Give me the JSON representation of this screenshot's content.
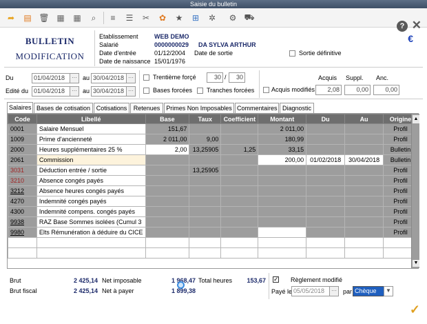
{
  "window": {
    "title": "Saisie du bulletin"
  },
  "toolbar": {
    "icons": [
      "back-arrow-icon",
      "document-icon",
      "trash-icon",
      "table-icon",
      "table-icon",
      "search-icon",
      "list-icon",
      "list-icon",
      "tools-icon",
      "gear-icon",
      "star-icon",
      "grid-icon",
      "gear-icon",
      "car-icon"
    ]
  },
  "header": {
    "title1": "BULLETIN",
    "title2": "MODIFICATION",
    "etab_label": "Etablissement",
    "etab_value": "WEB DEMO",
    "salarie_label": "Salarié",
    "salarie_id": "0000000029",
    "salarie_name": "DA SYLVA ARTHUR",
    "entree_label": "Date d'entrée",
    "entree_value": "01/12/2004",
    "sortie_label": "Date de sortie",
    "naissance_label": "Date de naissance",
    "naissance_value": "15/01/1976",
    "sortie_def_label": "Sortie définitive",
    "currency": "€"
  },
  "periods": {
    "du_label": "Du",
    "du_from": "01/04/2018",
    "au_label": "au",
    "du_to": "30/04/2018",
    "edite_label": "Edité du",
    "edite_from": "01/04/2018",
    "edite_au_label": "au",
    "edite_to": "30/04/2018",
    "trentieme_label": "Trentième forçé",
    "trentieme_num": "30",
    "trentieme_sep": "/",
    "trentieme_den": "30",
    "bases_label": "Bases forcées",
    "tranches_label": "Tranches forcées",
    "acquis_col": "Acquis",
    "suppl_col": "Suppl.",
    "anc_col": "Anc.",
    "acquis_mod_label": "Acquis modifiés",
    "acquis_value": "2,08",
    "suppl_value": "0,00",
    "anc_value": "0,00"
  },
  "tabs": [
    "Salaires",
    "Bases de cotisation",
    "Cotisations",
    "Retenues",
    "Primes Non Imposables",
    "Commentaires",
    "Diagnostic"
  ],
  "grid": {
    "headers": [
      "Code",
      "Libellé",
      "Base",
      "Taux",
      "Coefficient",
      "Montant",
      "Du",
      "Au",
      "Origine"
    ],
    "rows": [
      {
        "code": "0001",
        "label": "Salaire Mensuel",
        "base": "151,67",
        "taux": "",
        "coef": "",
        "montant": "2 011,00",
        "du": "",
        "au": "",
        "origine": "Profil"
      },
      {
        "code": "1009",
        "label": "Prime d'ancienneté",
        "base": "2 011,00",
        "taux": "9,00",
        "coef": "",
        "montant": "180,99",
        "du": "",
        "au": "",
        "origine": "Profil"
      },
      {
        "code": "2000",
        "label": "Heures supplémentaires 25 %",
        "base": "2,00",
        "taux": "13,25905",
        "coef": "1,25",
        "montant": "33,15",
        "du": "",
        "au": "",
        "origine": "Bulletin"
      },
      {
        "code": "2061",
        "label": "Commission",
        "base": "",
        "taux": "",
        "coef": "",
        "montant": "200,00",
        "du": "01/02/2018",
        "au": "30/04/2018",
        "origine": "Bulletin"
      },
      {
        "code": "3031",
        "label": "Déduction entrée / sortie",
        "base": "",
        "taux": "13,25905",
        "coef": "",
        "montant": "",
        "du": "",
        "au": "",
        "origine": "Profil"
      },
      {
        "code": "3210",
        "label": "Absence congés payés",
        "base": "",
        "taux": "",
        "coef": "",
        "montant": "",
        "du": "",
        "au": "",
        "origine": "Profil"
      },
      {
        "code": "3212",
        "label": "Absence heures congés payés",
        "base": "",
        "taux": "",
        "coef": "",
        "montant": "",
        "du": "",
        "au": "",
        "origine": "Profil"
      },
      {
        "code": "4270",
        "label": "Indemnité congés payés",
        "base": "",
        "taux": "",
        "coef": "",
        "montant": "",
        "du": "",
        "au": "",
        "origine": "Profil"
      },
      {
        "code": "4300",
        "label": "Indemnité compens. congés payés",
        "base": "",
        "taux": "",
        "coef": "",
        "montant": "",
        "du": "",
        "au": "",
        "origine": "Profil"
      },
      {
        "code": "9938",
        "label": "RAZ Base Sommes isolées (Cumul 3",
        "base": "",
        "taux": "",
        "coef": "",
        "montant": "",
        "du": "",
        "au": "",
        "origine": "Profil"
      },
      {
        "code": "9980",
        "label": "Elts Rémunération à déduire du CICE",
        "base": "",
        "taux": "",
        "coef": "",
        "montant": "",
        "du": "",
        "au": "",
        "origine": "Profil"
      }
    ]
  },
  "footer": {
    "brut_label": "Brut",
    "brut_value": "2 425,14",
    "brut_fiscal_label": "Brut fiscal",
    "brut_fiscal_value": "2 425,14",
    "net_imposable_label": "Net imposable",
    "net_imposable_value": "1 968,47",
    "net_payer_label": "Net à payer",
    "net_payer_value": "1 899,38",
    "total_heures_label": "Total heures",
    "total_heures_value": "153,67",
    "reglement_label": "Règlement modifié",
    "paye_label": "Payé le",
    "paye_value": "05/05/2018",
    "par_label": "par",
    "par_value": "Chèque"
  }
}
